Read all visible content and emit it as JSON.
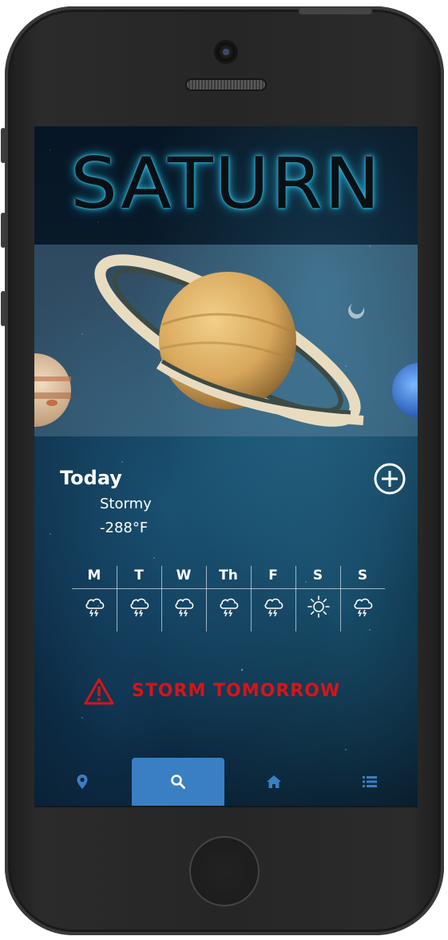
{
  "app": {
    "title": "SATURN"
  },
  "today": {
    "label": "Today",
    "condition": "Stormy",
    "temperature": "-288°F"
  },
  "forecast": [
    {
      "day": "M",
      "icon": "storm-cloud-icon"
    },
    {
      "day": "T",
      "icon": "storm-cloud-icon"
    },
    {
      "day": "W",
      "icon": "storm-cloud-icon"
    },
    {
      "day": "Th",
      "icon": "storm-cloud-icon"
    },
    {
      "day": "F",
      "icon": "storm-cloud-icon"
    },
    {
      "day": "S",
      "icon": "sun-icon"
    },
    {
      "day": "S",
      "icon": "storm-cloud-icon"
    }
  ],
  "alert": {
    "text": "STORM TOMORROW",
    "icon": "warning-triangle-icon",
    "color": "#d81418"
  },
  "nav": {
    "items": [
      {
        "name": "location",
        "icon": "map-pin-icon",
        "active": false
      },
      {
        "name": "search",
        "icon": "search-icon",
        "active": true
      },
      {
        "name": "home",
        "icon": "home-icon",
        "active": false
      },
      {
        "name": "list",
        "icon": "list-icon",
        "active": false
      }
    ]
  },
  "colors": {
    "accent": "#3a7fc4",
    "glow": "#2fb8d8",
    "alert": "#d81418"
  }
}
